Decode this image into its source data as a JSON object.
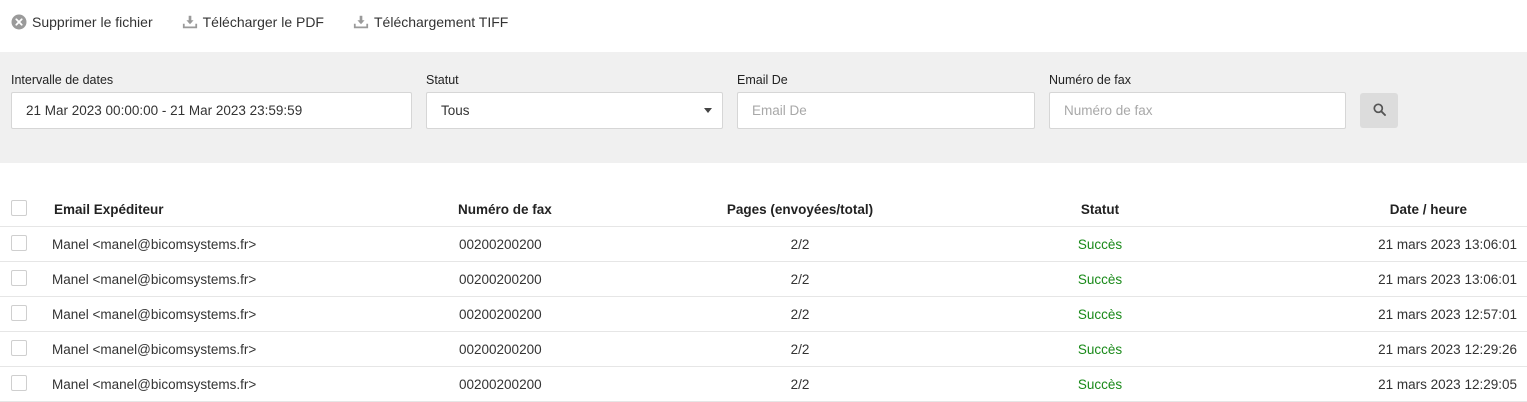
{
  "toolbar": {
    "delete_label": "Supprimer le fichier",
    "download_pdf_label": "Télécharger le PDF",
    "download_tiff_label": "Téléchargement TIFF"
  },
  "filters": {
    "date_range": {
      "label": "Intervalle de dates",
      "value": "21 Mar 2023 00:00:00 - 21 Mar 2023 23:59:59"
    },
    "status": {
      "label": "Statut",
      "value": "Tous"
    },
    "email_from": {
      "label": "Email De",
      "placeholder": "Email De"
    },
    "fax_number": {
      "label": "Numéro de fax",
      "placeholder": "Numéro de fax"
    }
  },
  "table": {
    "headers": {
      "email": "Email Expéditeur",
      "fax": "Numéro de fax",
      "pages": "Pages (envoyées/total)",
      "status": "Statut",
      "date": "Date / heure"
    },
    "rows": [
      {
        "email": "Manel <manel@bicomsystems.fr>",
        "fax": "00200200200",
        "pages": "2/2",
        "status": "Succès",
        "date": "21 mars 2023 13:06:01"
      },
      {
        "email": "Manel <manel@bicomsystems.fr>",
        "fax": "00200200200",
        "pages": "2/2",
        "status": "Succès",
        "date": "21 mars 2023 13:06:01"
      },
      {
        "email": "Manel <manel@bicomsystems.fr>",
        "fax": "00200200200",
        "pages": "2/2",
        "status": "Succès",
        "date": "21 mars 2023 12:57:01"
      },
      {
        "email": "Manel <manel@bicomsystems.fr>",
        "fax": "00200200200",
        "pages": "2/2",
        "status": "Succès",
        "date": "21 mars 2023 12:29:26"
      },
      {
        "email": "Manel <manel@bicomsystems.fr>",
        "fax": "00200200200",
        "pages": "2/2",
        "status": "Succès",
        "date": "21 mars 2023 12:29:05"
      }
    ]
  },
  "colors": {
    "filter_background": "#f0f0f0",
    "status_success": "#1a8a1a",
    "icon_gray": "#9a9a9a"
  },
  "icons": {
    "delete": "circle-x-icon",
    "download_pdf": "download-icon",
    "download_tiff": "download-icon",
    "search": "search-icon",
    "status_caret": "caret-down-icon"
  }
}
